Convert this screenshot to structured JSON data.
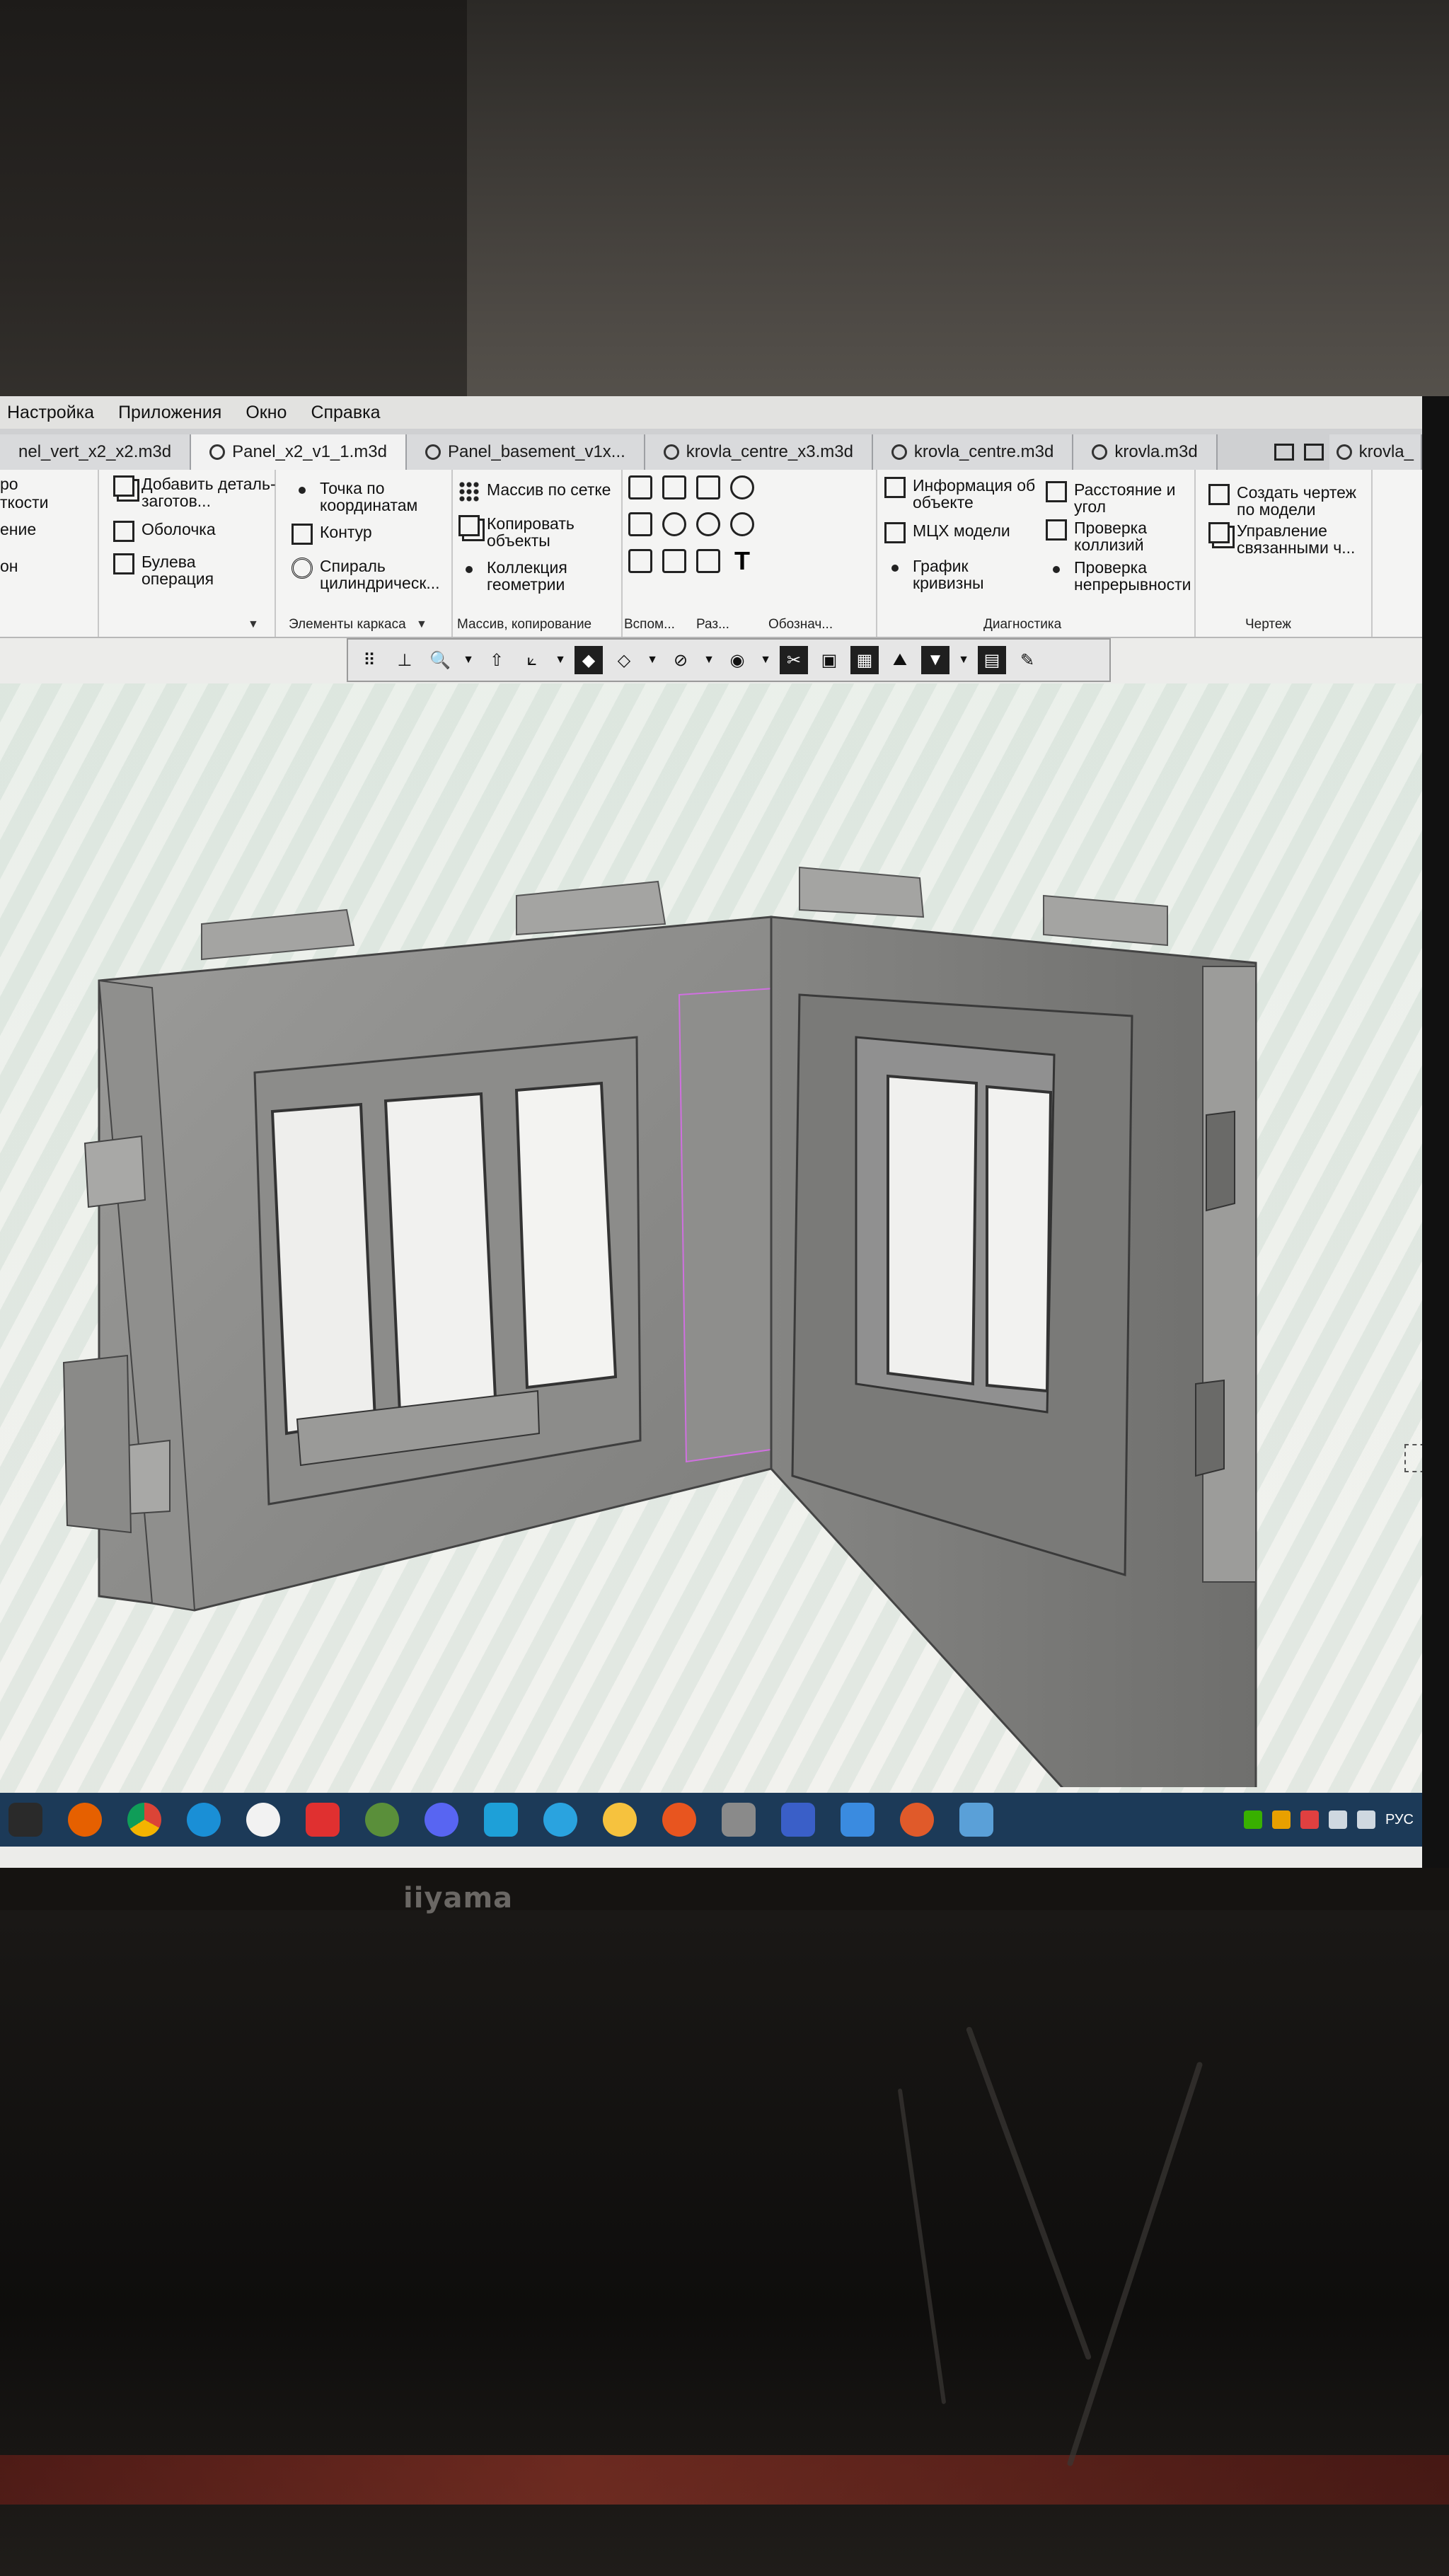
{
  "menu": [
    "Настройка",
    "Приложения",
    "Окно",
    "Справка"
  ],
  "tabs": [
    {
      "label": "nel_vert_x2_x2.m3d",
      "icon": false
    },
    {
      "label": "Panel_x2_v1_1.m3d",
      "icon": true
    },
    {
      "label": "Panel_basement_v1x...",
      "icon": true
    },
    {
      "label": "krovla_centre_x3.m3d",
      "icon": true
    },
    {
      "label": "krovla_centre.m3d",
      "icon": true
    },
    {
      "label": "krovla.m3d",
      "icon": true
    },
    {
      "label": "krovla_",
      "icon": true
    }
  ],
  "ribbon": {
    "left_partial": [
      "ро",
      "ткости",
      "ение",
      "он"
    ],
    "col1": [
      "Добавить деталь-заготов...",
      "Оболочка",
      "Булева операция"
    ],
    "col2": [
      "Точка по координатам",
      "Контур",
      "Спираль цилиндрическ..."
    ],
    "col2_label": "Элементы каркаса",
    "col3": [
      "Массив по сетке",
      "Копировать объекты",
      "Коллекция геометрии"
    ],
    "col3_label": "Массив, копирование",
    "vspom_label": "Вспом...",
    "razm_label": "Раз...",
    "oboznach_label": "Обознач...",
    "diag": [
      "Информация об объекте",
      "МЦХ модели",
      "График кривизны",
      "Расстояние и угол",
      "Проверка коллизий",
      "Проверка непрерывности"
    ],
    "diag_label": "Диагностика",
    "drawing": [
      "Создать чертеж по модели",
      "Управление связанными ч..."
    ],
    "drawing_label": "Чертеж"
  },
  "monitor_brand": "iiyama",
  "tray_lang": "РУС",
  "colors": {
    "taskbar": "#1c3a58",
    "model": "#8a8a88",
    "selection": "#d070e0"
  }
}
